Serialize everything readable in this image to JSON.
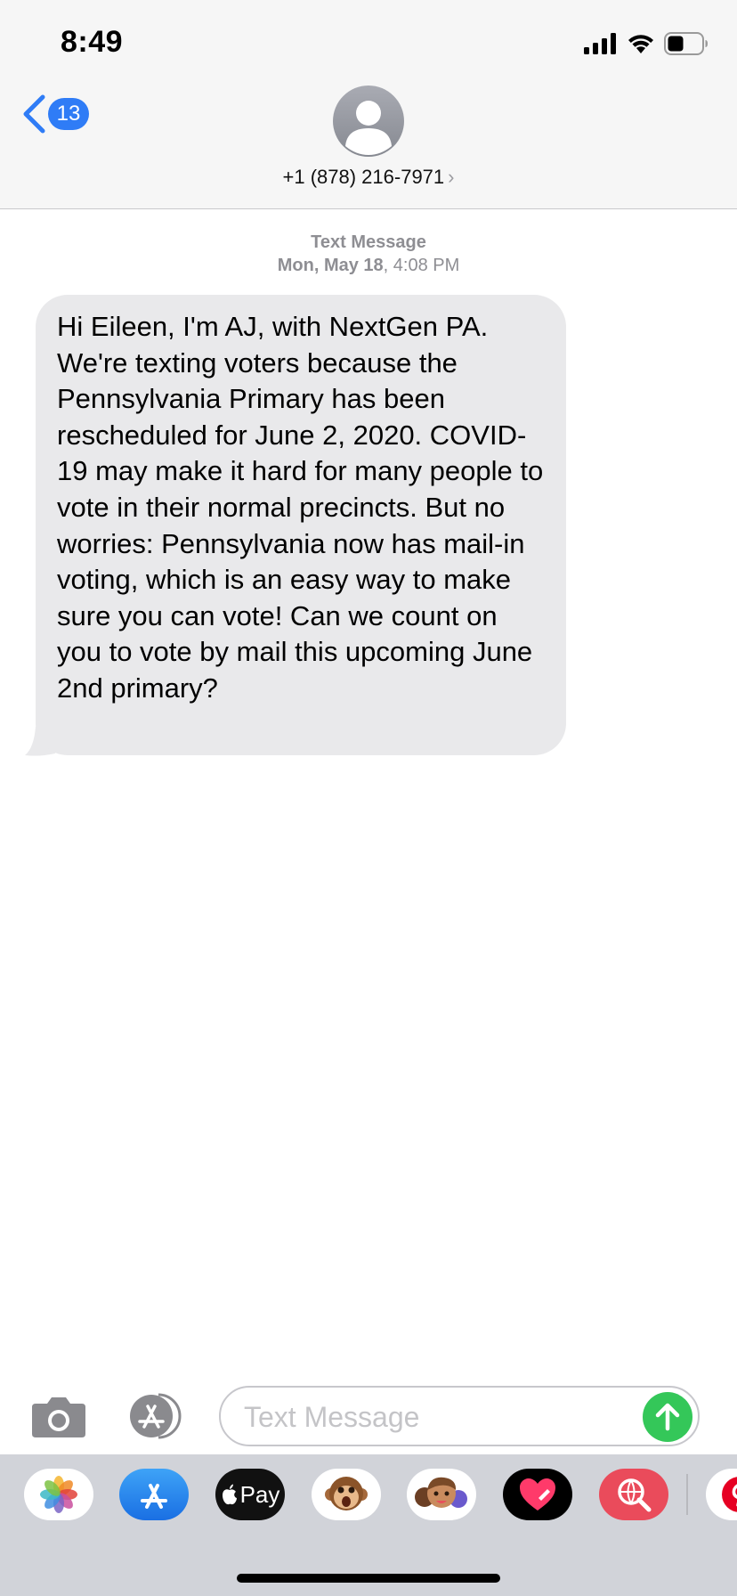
{
  "status_bar": {
    "time": "8:49"
  },
  "nav": {
    "back_count": "13",
    "contact_number": "+1 (878) 216-7971",
    "contact_chevron": "›"
  },
  "conversation": {
    "service_label": "Text Message",
    "date_bold": "Mon, May 18",
    "time": ", 4:08 PM",
    "message_text": "Hi Eileen, I'm AJ, with NextGen PA. We're texting voters because the Pennsylvania Primary has been rescheduled for June 2, 2020. COVID-19 may make it hard for many people to vote in their normal precincts. But no worries: Pennsylvania now has mail-in voting, which is an easy way to make sure you can vote! Can we count on you to vote by mail this upcoming June 2nd primary?"
  },
  "composer": {
    "placeholder": "Text Message"
  },
  "drawer": {
    "apps": [
      {
        "name": "photos",
        "icon": "photos-icon"
      },
      {
        "name": "app-store",
        "icon": "app-store-icon"
      },
      {
        "name": "apple-pay",
        "icon": "apple-pay-icon",
        "label": "Pay"
      },
      {
        "name": "animoji",
        "icon": "monkey-icon"
      },
      {
        "name": "memoji",
        "icon": "memoji-icon"
      },
      {
        "name": "digital-touch",
        "icon": "heart-icon"
      },
      {
        "name": "images-search",
        "icon": "globe-search-icon"
      },
      {
        "name": "pinterest",
        "icon": "pinterest-icon"
      }
    ]
  },
  "colors": {
    "accent_blue": "#2f7cf6",
    "send_green": "#34c759",
    "bubble_gray": "#e9e9eb",
    "drawer_bg": "#d1d3d9"
  }
}
